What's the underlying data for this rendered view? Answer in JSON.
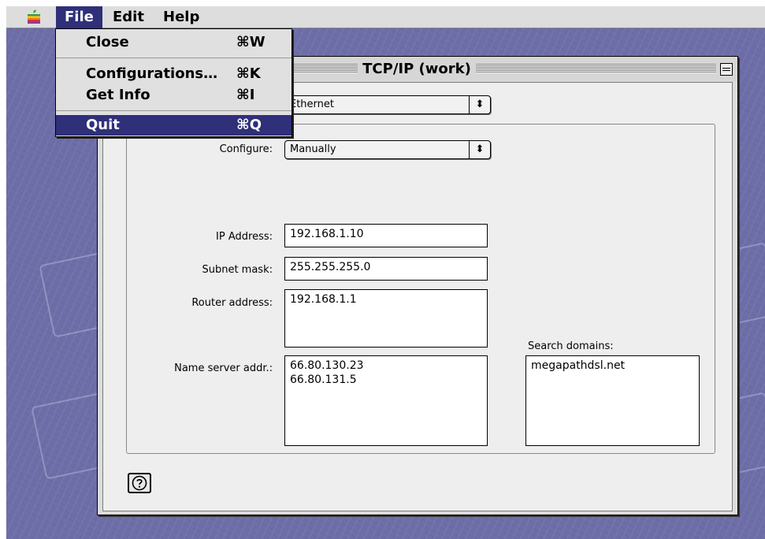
{
  "menubar": {
    "apple_icon": "apple-icon",
    "file": "File",
    "edit": "Edit",
    "help": "Help"
  },
  "file_menu": {
    "items": [
      {
        "label": "Close",
        "shortcut": "⌘W"
      },
      {
        "label": "Configurations…",
        "shortcut": "⌘K"
      },
      {
        "label": "Get Info",
        "shortcut": "⌘I"
      },
      {
        "label": "Quit",
        "shortcut": "⌘Q"
      }
    ],
    "selected": "Quit"
  },
  "window": {
    "title": "TCP/IP (work)",
    "connect_via_value": "Ethernet",
    "configure_label": "Configure:",
    "configure_value": "Manually",
    "ip_label": "IP Address:",
    "ip_value": "192.168.1.10",
    "subnet_label": "Subnet mask:",
    "subnet_value": "255.255.255.0",
    "router_label": "Router address:",
    "router_value": "192.168.1.1",
    "dns_label": "Name server addr.:",
    "dns_values": [
      "66.80.130.23",
      "66.80.131.5"
    ],
    "search_label": "Search domains:",
    "search_value": "megapathdsl.net",
    "help_icon": "question-mark-icon"
  },
  "colors": {
    "desktop": "#6d6da8",
    "menu_highlight": "#2f2f7a"
  }
}
